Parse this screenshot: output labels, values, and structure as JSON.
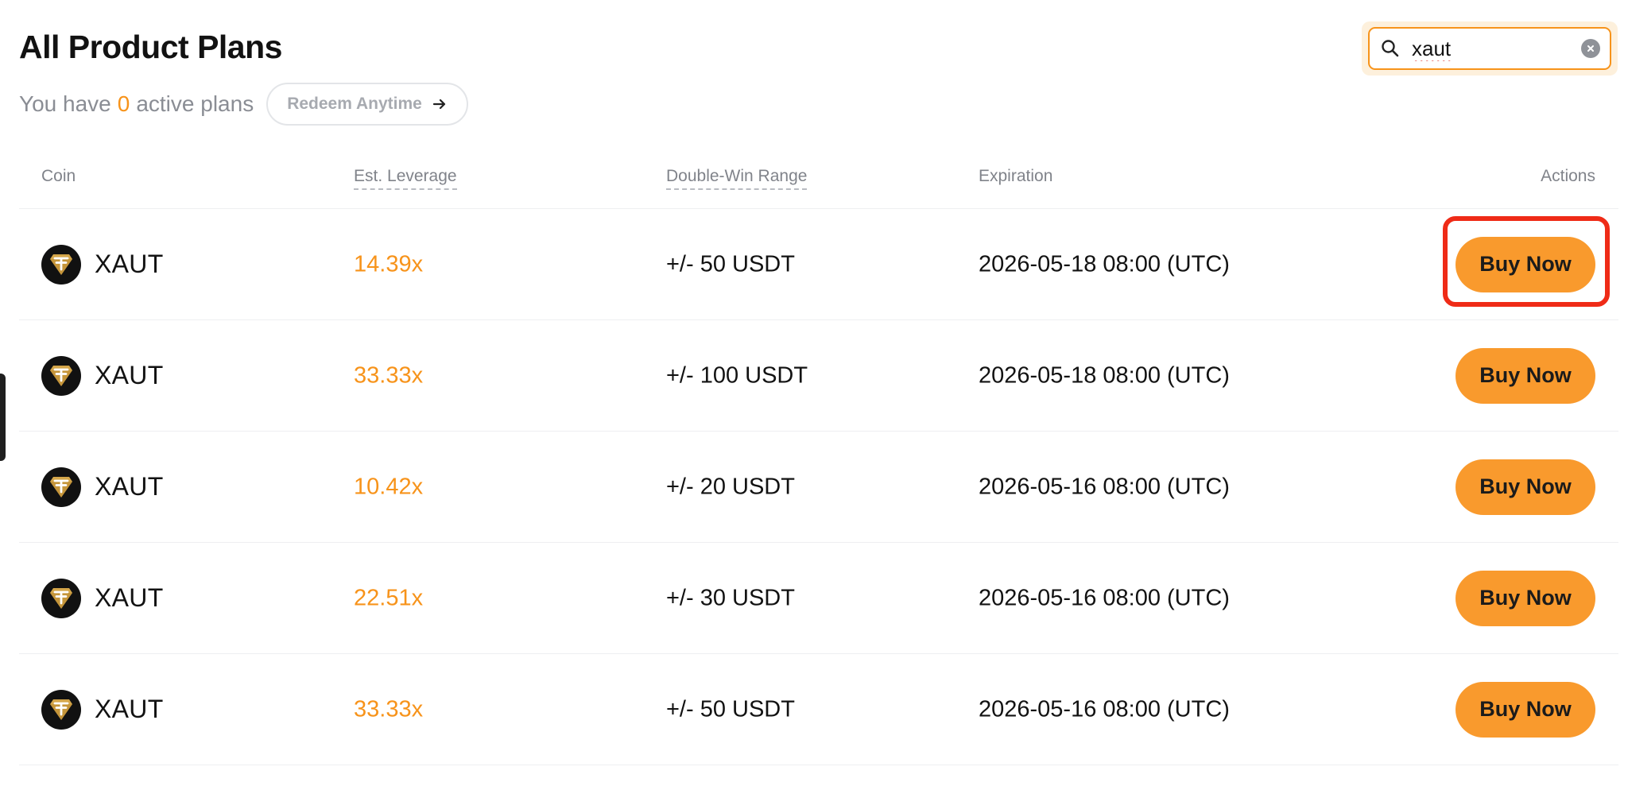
{
  "page": {
    "title": "All Product Plans",
    "subline_prefix": "You have",
    "active_count": "0",
    "subline_suffix": "active plans",
    "redeem_label": "Redeem Anytime"
  },
  "search": {
    "value": "xaut",
    "placeholder": ""
  },
  "table": {
    "headers": {
      "coin": "Coin",
      "leverage": "Est. Leverage",
      "range": "Double-Win Range",
      "expiration": "Expiration",
      "actions": "Actions"
    },
    "rows": [
      {
        "coin": "XAUT",
        "leverage": "14.39x",
        "range": "+/- 50 USDT",
        "expiration": "2026-05-18 08:00 (UTC)",
        "action": "Buy Now"
      },
      {
        "coin": "XAUT",
        "leverage": "33.33x",
        "range": "+/- 100 USDT",
        "expiration": "2026-05-18 08:00 (UTC)",
        "action": "Buy Now"
      },
      {
        "coin": "XAUT",
        "leverage": "10.42x",
        "range": "+/- 20 USDT",
        "expiration": "2026-05-16 08:00 (UTC)",
        "action": "Buy Now"
      },
      {
        "coin": "XAUT",
        "leverage": "22.51x",
        "range": "+/- 30 USDT",
        "expiration": "2026-05-16 08:00 (UTC)",
        "action": "Buy Now"
      },
      {
        "coin": "XAUT",
        "leverage": "33.33x",
        "range": "+/- 50 USDT",
        "expiration": "2026-05-16 08:00 (UTC)",
        "action": "Buy Now"
      }
    ]
  },
  "icons": {
    "search": "search-icon",
    "clear": "clear-icon",
    "arrow": "arrow-right-icon",
    "coin": "xaut-coin-logo-icon"
  },
  "colors": {
    "accent": "#f7931a",
    "button": "#f99a2d",
    "highlight": "#ef2b17"
  }
}
